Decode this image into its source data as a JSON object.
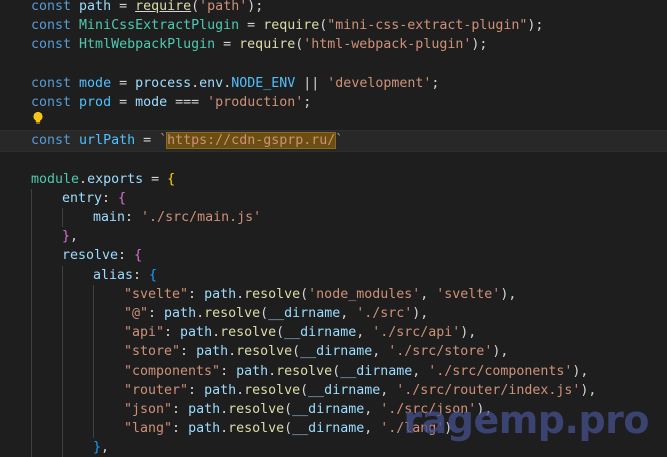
{
  "editor": {
    "language": "javascript",
    "theme_colors": {
      "background": "#1e1e1e",
      "keyword": "#569cd6",
      "variable": "#9cdcfe",
      "constant": "#4fc1ff",
      "class": "#4ec9b0",
      "function": "#dcdcaa",
      "string": "#ce9178",
      "bracket_1": "#ffd700",
      "bracket_2": "#da70d6",
      "bracket_3": "#179fff",
      "highlight_bg": "#6b4e12"
    },
    "lightbulb_icon": "lightbulb-icon",
    "lines": [
      {
        "indent": 0,
        "tokens": [
          [
            "kw",
            "const"
          ],
          [
            "op",
            " "
          ],
          [
            "var",
            "path"
          ],
          [
            "op",
            " = "
          ],
          [
            "fn",
            "require"
          ],
          [
            "op",
            "("
          ],
          [
            "str",
            "'path'"
          ],
          [
            "op",
            ");"
          ]
        ]
      },
      {
        "indent": 0,
        "tokens": [
          [
            "kw",
            "const"
          ],
          [
            "op",
            " "
          ],
          [
            "cls",
            "MiniCssExtractPlugin"
          ],
          [
            "op",
            " = "
          ],
          [
            "fn",
            "require"
          ],
          [
            "op",
            "("
          ],
          [
            "str",
            "\"mini-css-extract-plugin\""
          ],
          [
            "op",
            ");"
          ]
        ]
      },
      {
        "indent": 0,
        "tokens": [
          [
            "kw",
            "const"
          ],
          [
            "op",
            " "
          ],
          [
            "cls",
            "HtmlWebpackPlugin"
          ],
          [
            "op",
            " = "
          ],
          [
            "fn",
            "require"
          ],
          [
            "op",
            "("
          ],
          [
            "str",
            "'html-webpack-plugin'"
          ],
          [
            "op",
            ");"
          ]
        ]
      },
      {
        "indent": 0,
        "tokens": []
      },
      {
        "indent": 0,
        "tokens": [
          [
            "kw",
            "const"
          ],
          [
            "op",
            " "
          ],
          [
            "const",
            "mode"
          ],
          [
            "op",
            " = "
          ],
          [
            "var",
            "process"
          ],
          [
            "op",
            "."
          ],
          [
            "var",
            "env"
          ],
          [
            "op",
            "."
          ],
          [
            "const",
            "NODE_ENV"
          ],
          [
            "op",
            " || "
          ],
          [
            "str",
            "'development'"
          ],
          [
            "op",
            ";"
          ]
        ]
      },
      {
        "indent": 0,
        "tokens": [
          [
            "kw",
            "const"
          ],
          [
            "op",
            " "
          ],
          [
            "const",
            "prod"
          ],
          [
            "op",
            " = "
          ],
          [
            "var",
            "mode"
          ],
          [
            "op",
            " === "
          ],
          [
            "str",
            "'production'"
          ],
          [
            "op",
            ";"
          ]
        ]
      },
      {
        "indent": 0,
        "tokens": []
      },
      {
        "indent": 0,
        "current": true,
        "tokens": [
          [
            "kw",
            "const"
          ],
          [
            "op",
            " "
          ],
          [
            "const",
            "urlPath"
          ],
          [
            "op",
            " = "
          ],
          [
            "str",
            "`"
          ],
          [
            "hl",
            "https://cdn-gsprp.ru/"
          ],
          [
            "str",
            "`"
          ]
        ]
      },
      {
        "indent": 0,
        "tokens": []
      },
      {
        "indent": 0,
        "tokens": [
          [
            "cls",
            "module"
          ],
          [
            "op",
            "."
          ],
          [
            "var",
            "exports"
          ],
          [
            "op",
            " = "
          ],
          [
            "br",
            "{"
          ]
        ]
      },
      {
        "indent": 1,
        "tokens": [
          [
            "var",
            "entry"
          ],
          [
            "op",
            ": "
          ],
          [
            "br2",
            "{"
          ]
        ]
      },
      {
        "indent": 2,
        "tokens": [
          [
            "var",
            "main"
          ],
          [
            "op",
            ": "
          ],
          [
            "str",
            "'./src/main.js'"
          ]
        ]
      },
      {
        "indent": 1,
        "tokens": [
          [
            "br2",
            "}"
          ],
          [
            "op",
            ","
          ]
        ]
      },
      {
        "indent": 1,
        "tokens": [
          [
            "var",
            "resolve"
          ],
          [
            "op",
            ": "
          ],
          [
            "br2",
            "{"
          ]
        ]
      },
      {
        "indent": 2,
        "tokens": [
          [
            "var",
            "alias"
          ],
          [
            "op",
            ": "
          ],
          [
            "br3",
            "{"
          ]
        ]
      },
      {
        "indent": 3,
        "tokens": [
          [
            "str",
            "\"svelte\""
          ],
          [
            "op",
            ": "
          ],
          [
            "var",
            "path"
          ],
          [
            "op",
            "."
          ],
          [
            "fn",
            "resolve"
          ],
          [
            "op",
            "("
          ],
          [
            "str",
            "'node_modules'"
          ],
          [
            "op",
            ", "
          ],
          [
            "str",
            "'svelte'"
          ],
          [
            "op",
            "),"
          ]
        ]
      },
      {
        "indent": 3,
        "tokens": [
          [
            "str",
            "\"@\""
          ],
          [
            "op",
            ": "
          ],
          [
            "var",
            "path"
          ],
          [
            "op",
            "."
          ],
          [
            "fn",
            "resolve"
          ],
          [
            "op",
            "("
          ],
          [
            "var",
            "__dirname"
          ],
          [
            "op",
            ", "
          ],
          [
            "str",
            "'./src'"
          ],
          [
            "op",
            "),"
          ]
        ]
      },
      {
        "indent": 3,
        "tokens": [
          [
            "str",
            "\"api\""
          ],
          [
            "op",
            ": "
          ],
          [
            "var",
            "path"
          ],
          [
            "op",
            "."
          ],
          [
            "fn",
            "resolve"
          ],
          [
            "op",
            "("
          ],
          [
            "var",
            "__dirname"
          ],
          [
            "op",
            ", "
          ],
          [
            "str",
            "'./src/api'"
          ],
          [
            "op",
            "),"
          ]
        ]
      },
      {
        "indent": 3,
        "tokens": [
          [
            "str",
            "\"store\""
          ],
          [
            "op",
            ": "
          ],
          [
            "var",
            "path"
          ],
          [
            "op",
            "."
          ],
          [
            "fn",
            "resolve"
          ],
          [
            "op",
            "("
          ],
          [
            "var",
            "__dirname"
          ],
          [
            "op",
            ", "
          ],
          [
            "str",
            "'./src/store'"
          ],
          [
            "op",
            "),"
          ]
        ]
      },
      {
        "indent": 3,
        "tokens": [
          [
            "str",
            "\"components\""
          ],
          [
            "op",
            ": "
          ],
          [
            "var",
            "path"
          ],
          [
            "op",
            "."
          ],
          [
            "fn",
            "resolve"
          ],
          [
            "op",
            "("
          ],
          [
            "var",
            "__dirname"
          ],
          [
            "op",
            ", "
          ],
          [
            "str",
            "'./src/components'"
          ],
          [
            "op",
            "),"
          ]
        ]
      },
      {
        "indent": 3,
        "tokens": [
          [
            "str",
            "\"router\""
          ],
          [
            "op",
            ": "
          ],
          [
            "var",
            "path"
          ],
          [
            "op",
            "."
          ],
          [
            "fn",
            "resolve"
          ],
          [
            "op",
            "("
          ],
          [
            "var",
            "__dirname"
          ],
          [
            "op",
            ", "
          ],
          [
            "str",
            "'./src/router/index.js'"
          ],
          [
            "op",
            "),"
          ]
        ]
      },
      {
        "indent": 3,
        "tokens": [
          [
            "str",
            "\"json\""
          ],
          [
            "op",
            ": "
          ],
          [
            "var",
            "path"
          ],
          [
            "op",
            "."
          ],
          [
            "fn",
            "resolve"
          ],
          [
            "op",
            "("
          ],
          [
            "var",
            "__dirname"
          ],
          [
            "op",
            ", "
          ],
          [
            "str",
            "'./src/json'"
          ],
          [
            "op",
            "),"
          ]
        ]
      },
      {
        "indent": 3,
        "tokens": [
          [
            "str",
            "\"lang\""
          ],
          [
            "op",
            ": "
          ],
          [
            "var",
            "path"
          ],
          [
            "op",
            "."
          ],
          [
            "fn",
            "resolve"
          ],
          [
            "op",
            "("
          ],
          [
            "var",
            "__dirname"
          ],
          [
            "op",
            ", "
          ],
          [
            "str",
            "'./lang'"
          ],
          [
            "op",
            ")"
          ]
        ]
      },
      {
        "indent": 2,
        "tokens": [
          [
            "br3",
            "}"
          ],
          [
            "op",
            ","
          ]
        ]
      }
    ]
  },
  "watermark": {
    "text": "ragemp.pro"
  }
}
